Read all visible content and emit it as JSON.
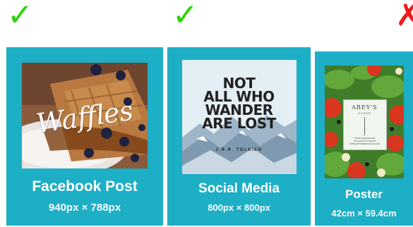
{
  "marks": [
    {
      "symbol": "✓",
      "status": "allowed",
      "color": "#2bd400"
    },
    {
      "symbol": "✓",
      "status": "allowed",
      "color": "#2bd400"
    },
    {
      "symbol": "✗",
      "status": "not-allowed",
      "color": "#f01a1a"
    }
  ],
  "cards": [
    {
      "title": "Facebook Post",
      "size": "940px × 788px",
      "thumbnail_text": "Waffles"
    },
    {
      "title": "Social Media",
      "size": "800px × 800px",
      "thumbnail_text": {
        "lines": [
          "NOT",
          "ALL WHO",
          "WANDER",
          "ARE LOST"
        ],
        "author": "J.R.R. TOLKIEN"
      }
    },
    {
      "title": "Poster",
      "size": "42cm × 59.4cm",
      "thumbnail_text": {
        "heading": "ABEY'S",
        "subheading": "CLASS",
        "fine_print": [
          "TO DO DOODLE AND",
          "COLLAGE AT THE HAT",
          "WWW.ARTSIDESOCIALS.COM"
        ]
      }
    }
  ],
  "colors": {
    "card_bg": "#1dafc6",
    "card_text": "#ffffff",
    "check": "#2bd400",
    "cross": "#f01a1a"
  }
}
